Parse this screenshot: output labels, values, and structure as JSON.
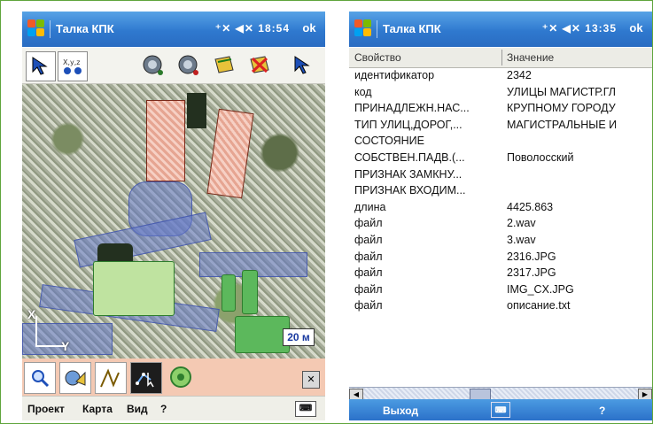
{
  "left_device": {
    "title": "Талка КПК",
    "status_icons": "⁺✕ ◀✕",
    "time": "18:54",
    "ok_label": "ok",
    "map": {
      "axis_x": "X",
      "axis_y": "Y",
      "scale": "20 м"
    },
    "close_label": "✕",
    "menu": [
      "Проект",
      "Карта",
      "Вид",
      "?"
    ]
  },
  "right_device": {
    "title": "Талка КПК",
    "status_icons": "⁺✕ ◀✕",
    "time": "13:35",
    "ok_label": "ok",
    "columns": [
      "Свойство",
      "Значение"
    ],
    "rows": [
      [
        "идентификатор",
        "2342"
      ],
      [
        "код",
        "УЛИЦЫ МАГИСТР.ГЛ"
      ],
      [
        "ПРИНАДЛЕЖН.НАС...",
        "КРУПНОМУ ГОРОДУ"
      ],
      [
        "ТИП УЛИЦ,ДОРОГ,...",
        "МАГИСТРАЛЬНЫЕ И"
      ],
      [
        "СОСТОЯНИЕ",
        ""
      ],
      [
        "СОБСТВЕН.ПАДВ.(...",
        "Поволосский"
      ],
      [
        "ПРИЗНАК ЗАМКНУ...",
        ""
      ],
      [
        "ПРИЗНАК ВХОДИМ...",
        ""
      ],
      [
        "длина",
        "4425.863"
      ],
      [
        "файл",
        "2.wav"
      ],
      [
        "файл",
        "3.wav"
      ],
      [
        "файл",
        "2316.JPG"
      ],
      [
        "файл",
        "2317.JPG"
      ],
      [
        "файл",
        "IMG_CX.JPG"
      ],
      [
        "файл",
        "описание.txt"
      ]
    ],
    "softkeys": {
      "left": "Выход",
      "right": "?"
    }
  },
  "icons": {
    "pointer": "pointer-arrow-icon",
    "xyz": "xyz-coordinates-icon",
    "globe": "globe-icon",
    "layers": "layers-icon",
    "zoom": "magnifier-icon",
    "keyboard": "keyboard-icon"
  }
}
